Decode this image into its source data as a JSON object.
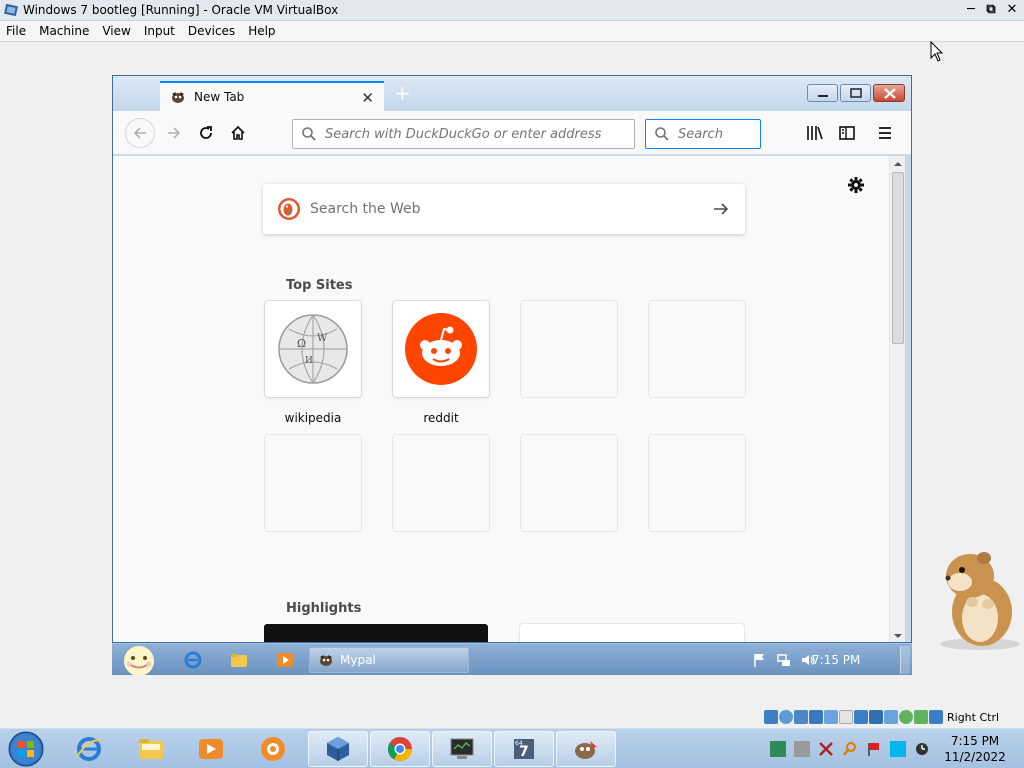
{
  "host": {
    "window_title": "Windows 7 bootleg [Running] - Oracle VM VirtualBox",
    "menu": [
      "File",
      "Machine",
      "View",
      "Input",
      "Devices",
      "Help"
    ],
    "status_right_ctrl": "Right Ctrl",
    "clock_time": "7:15 PM",
    "clock_date": "11/2/2022"
  },
  "browser": {
    "tab_title": "New Tab",
    "url_placeholder": "Search with DuckDuckGo or enter address",
    "search_placeholder": "Search",
    "content": {
      "web_search_placeholder": "Search the Web",
      "top_sites_title": "Top Sites",
      "top_sites": [
        {
          "label": "wikipedia",
          "icon": "wikipedia-globe-icon"
        },
        {
          "label": "reddit",
          "icon": "reddit-alien-icon"
        },
        {
          "label": "",
          "icon": ""
        },
        {
          "label": "",
          "icon": ""
        },
        {
          "label": "",
          "icon": ""
        },
        {
          "label": "",
          "icon": ""
        },
        {
          "label": "",
          "icon": ""
        },
        {
          "label": "",
          "icon": ""
        }
      ],
      "highlights_title": "Highlights"
    }
  },
  "guest_taskbar": {
    "task_label": "Mypal",
    "clock": "7:15 PM"
  },
  "colors": {
    "accent": "#0a84ff",
    "reddit": "#ff4500",
    "ddg": "#de5833"
  }
}
